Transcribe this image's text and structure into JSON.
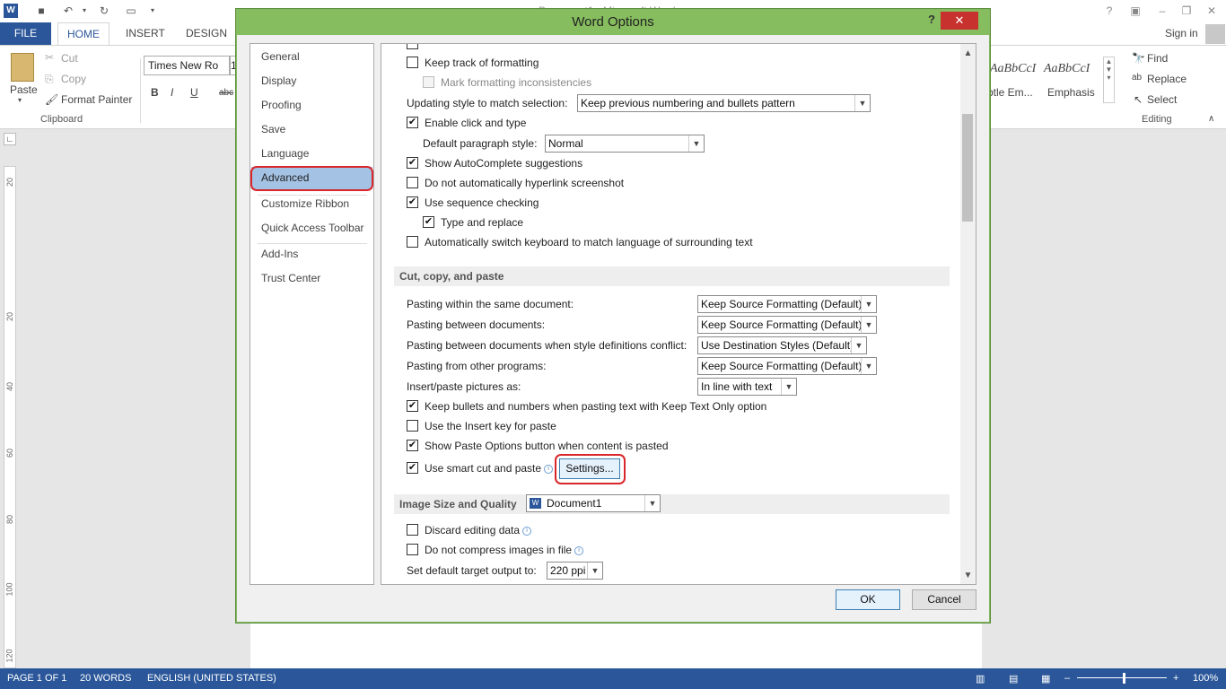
{
  "app": {
    "window_title": "Document1 - Microsoft Word",
    "help": "?",
    "signin": "Sign in",
    "tabs": {
      "file": "FILE",
      "home": "HOME",
      "insert": "INSERT",
      "design": "DESIGN"
    }
  },
  "ribbon": {
    "paste": "Paste",
    "cut": "Cut",
    "copy": "Copy",
    "format_painter": "Format Painter",
    "clipboard": "Clipboard",
    "font_name": "Times New Ro",
    "font_size": "1",
    "bold": "B",
    "italic": "I",
    "underline": "U",
    "strike": "abc",
    "style1_preview": "AaBbCcI",
    "style1_name": "btle Em...",
    "style2_preview": "AaBbCcI",
    "style2_name": "Emphasis",
    "find": "Find",
    "replace": "Replace",
    "select": "Select",
    "editing": "Editing"
  },
  "ruler": [
    "20",
    "20",
    "40",
    "60",
    "80",
    "100",
    "120"
  ],
  "status": {
    "page": "PAGE 1 OF 1",
    "words": "20 WORDS",
    "language": "ENGLISH (UNITED STATES)",
    "zoom": "100%"
  },
  "dialog": {
    "title": "Word Options",
    "help": "?",
    "close": "✕",
    "nav": [
      "General",
      "Display",
      "Proofing",
      "Save",
      "Language",
      "Advanced",
      "Customize Ribbon",
      "Quick Access Toolbar",
      "Add-Ins",
      "Trust Center"
    ],
    "selected_nav": "Advanced",
    "ok": "OK",
    "cancel": "Cancel",
    "editing": {
      "keep_track": {
        "label": "Keep track of formatting",
        "checked": false
      },
      "mark_inconsistencies": {
        "label": "Mark formatting inconsistencies",
        "checked": false,
        "disabled": true
      },
      "updating_style_label": "Updating style to match selection:",
      "updating_style_value": "Keep previous numbering and bullets pattern",
      "click_and_type": {
        "label": "Enable click and type",
        "checked": true
      },
      "default_para_label": "Default paragraph style:",
      "default_para_value": "Normal",
      "autocomplete": {
        "label": "Show AutoComplete suggestions",
        "checked": true
      },
      "no_hyperlink": {
        "label": "Do not automatically hyperlink screenshot",
        "checked": false
      },
      "sequence": {
        "label": "Use sequence checking",
        "checked": true
      },
      "type_replace": {
        "label": "Type and replace",
        "checked": true
      },
      "auto_keyboard": {
        "label": "Automatically switch keyboard to match language of surrounding text",
        "checked": false
      }
    },
    "cut_copy_paste": {
      "header": "Cut, copy, and paste",
      "same_doc_label": "Pasting within the same document:",
      "same_doc_value": "Keep Source Formatting (Default)",
      "between_docs_label": "Pasting between documents:",
      "between_docs_value": "Keep Source Formatting (Default)",
      "conflict_label": "Pasting between documents when style definitions conflict:",
      "conflict_value": "Use Destination Styles (Default)",
      "other_programs_label": "Pasting from other programs:",
      "other_programs_value": "Keep Source Formatting (Default)",
      "pictures_label": "Insert/paste pictures as:",
      "pictures_value": "In line with text",
      "keep_bullets": {
        "label": "Keep bullets and numbers when pasting text with Keep Text Only option",
        "checked": true
      },
      "insert_key": {
        "label": "Use the Insert key for paste",
        "checked": false
      },
      "paste_options": {
        "label": "Show Paste Options button when content is pasted",
        "checked": true
      },
      "smart_cut": {
        "label": "Use smart cut and paste",
        "checked": true
      },
      "settings_button": "Settings..."
    },
    "image_quality": {
      "header": "Image Size and Quality",
      "document": "Document1",
      "discard_editing": {
        "label": "Discard editing data",
        "checked": false
      },
      "no_compress": {
        "label": "Do not compress images in file",
        "checked": false
      },
      "target_output_label": "Set default target output to:",
      "target_output_value": "220 ppi"
    }
  },
  "colors": {
    "word_blue": "#2b579a",
    "dialog_title": "#86bd5e",
    "highlight_oval": "#d9262a",
    "nav_selected": "#a4c2e4"
  }
}
